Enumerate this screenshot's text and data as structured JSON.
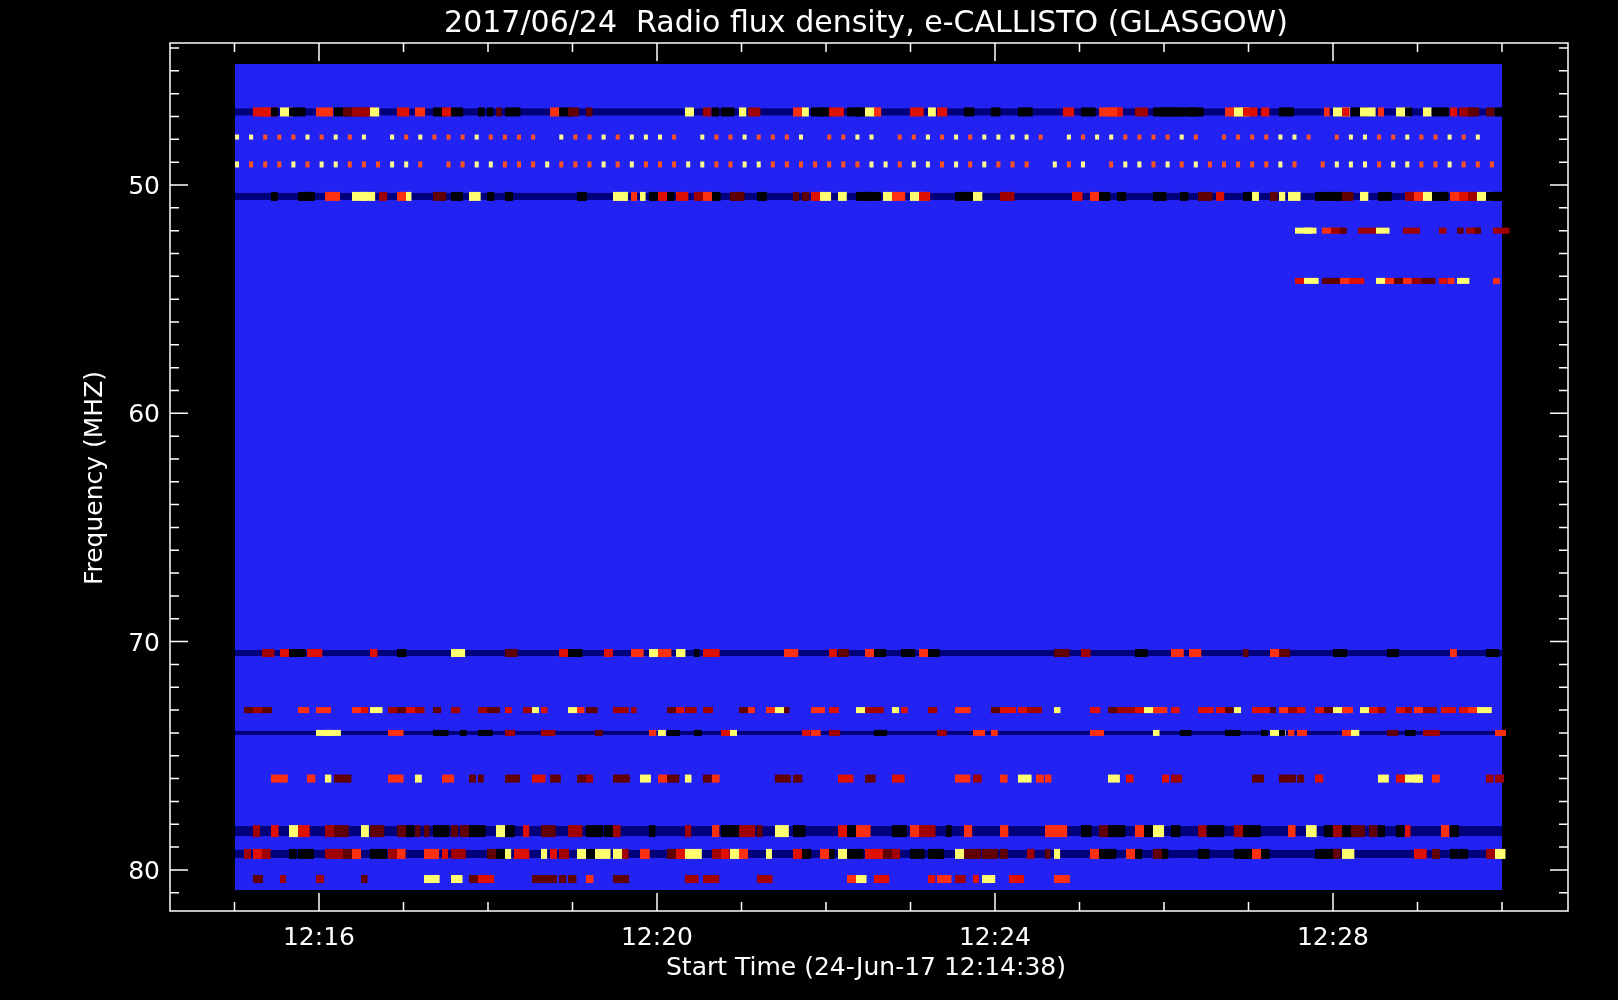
{
  "title": "2017/06/24  Radio flux density, e-CALLISTO (GLASGOW)",
  "y_axis": {
    "label": "Frequency (MHZ)",
    "ticks": [
      "50",
      "60",
      "70",
      "80"
    ]
  },
  "x_axis": {
    "label": "Start Time (24-Jun-17 12:14:38)",
    "ticks": [
      "12:16",
      "12:20",
      "12:24",
      "12:28"
    ]
  }
}
